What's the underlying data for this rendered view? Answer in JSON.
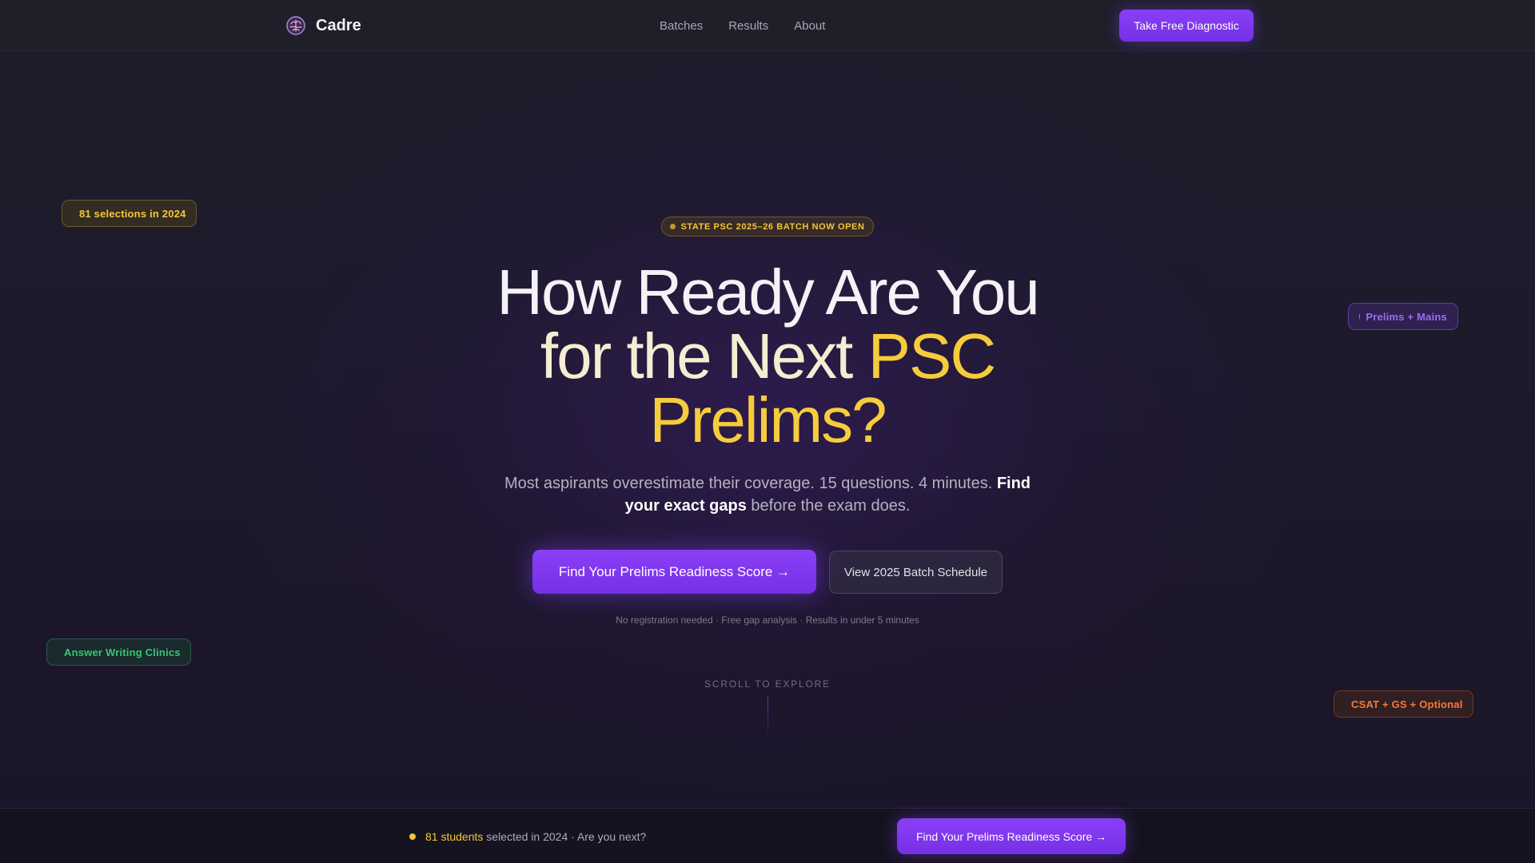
{
  "nav": {
    "brand": "Cadre",
    "brand_icon": "brain-icon",
    "links": [
      "Batches",
      "Results",
      "About"
    ],
    "cta_label": "Take Free Diagnostic"
  },
  "floating_badges": {
    "selections": "81 selections in 2024",
    "prelims_mains": "Prelims + Mains",
    "answer_writing": "Answer Writing Clinics",
    "csat": "CSAT + GS + Optional"
  },
  "hero": {
    "batch_pill": "STATE PSC 2025–26 BATCH NOW OPEN",
    "headline": {
      "line1": "How Ready Are You",
      "line2_a": "for the Next ",
      "line2_b": "PSC",
      "line3": "Prelims?"
    },
    "subtext": {
      "part1": "Most aspirants overestimate their coverage. 15 questions. 4 minutes. ",
      "bold": "Find your exact gaps",
      "part2": " before the exam does."
    },
    "primary_cta": "Find Your Prelims Readiness Score →",
    "secondary_cta": "View 2025 Batch Schedule",
    "fineprint": "No registration needed · Free gap analysis · Results in under 5 minutes",
    "scroll_label": "SCROLL TO EXPLORE"
  },
  "bottom_bar": {
    "highlight": "81 students",
    "text": "selected in 2024 · Are you next?",
    "cta": "Find Your Prelims Readiness Score →"
  },
  "colors": {
    "accent_purple": "#7c3aed",
    "accent_gold": "#f6cc3c",
    "background": "#1c1a28"
  }
}
